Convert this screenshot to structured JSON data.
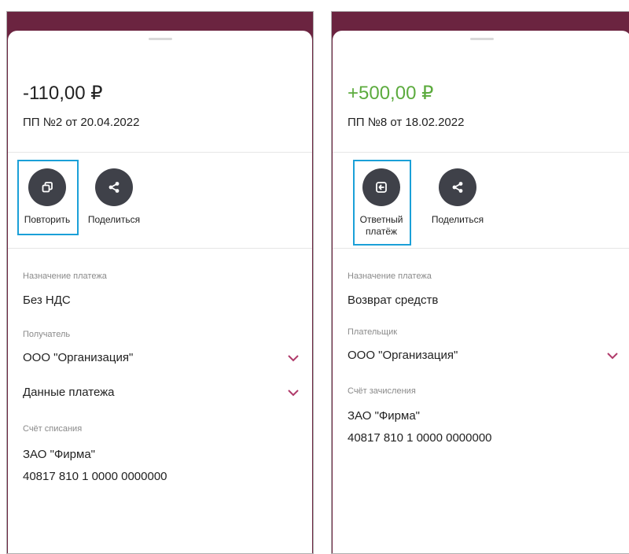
{
  "colors": {
    "header_maroon": "#6b2440",
    "positive_green": "#5cab3e",
    "highlight_blue": "#1ba0d8",
    "action_circle": "#3f4149",
    "chevron_accent": "#b03a6a"
  },
  "left": {
    "amount": "-110,00 ₽",
    "document": "ПП №2 от 20.04.2022",
    "actions": [
      {
        "label": "Повторить",
        "icon": "copy-icon",
        "highlighted": true
      },
      {
        "label": "Поделиться",
        "icon": "share-icon",
        "highlighted": false
      }
    ],
    "purpose_caption": "Назначение платежа",
    "purpose_value": "Без НДС",
    "recipient_caption": "Получатель",
    "recipient_value": "ООО \"Организация\"",
    "payment_data_label": "Данные платежа",
    "account_caption": "Счёт списания",
    "account_name": "ЗАО \"Фирма\"",
    "account_number": "40817 810 1 0000 0000000"
  },
  "right": {
    "amount": "+500,00 ₽",
    "document": "ПП №8 от 18.02.2022",
    "actions": [
      {
        "label_line1": "Ответный",
        "label_line2": "платёж",
        "icon": "reply-payment-icon",
        "highlighted": true
      },
      {
        "label": "Поделиться",
        "icon": "share-icon",
        "highlighted": false
      }
    ],
    "purpose_caption": "Назначение платежа",
    "purpose_value": "Возврат средств",
    "payer_caption": "Плательщик",
    "payer_value": "ООО \"Организация\"",
    "account_caption": "Счёт зачисления",
    "account_name": "ЗАО \"Фирма\"",
    "account_number": "40817 810 1 0000 0000000"
  }
}
